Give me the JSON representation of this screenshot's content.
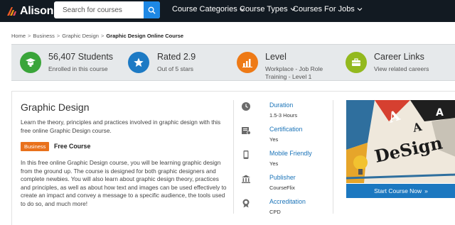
{
  "brand": {
    "name": "Alison"
  },
  "search": {
    "placeholder": "Search for courses"
  },
  "nav": [
    {
      "label": "Course Categories"
    },
    {
      "label": "Course Types"
    },
    {
      "label": "Courses For Jobs"
    }
  ],
  "breadcrumb": [
    "Home",
    "Business",
    "Graphic Design",
    "Graphic Design Online Course"
  ],
  "stats": [
    {
      "title": "56,407 Students",
      "sub": "Enrolled in this course",
      "color": "#3aa53a",
      "icon": "graduate-icon"
    },
    {
      "title": "Rated 2.9",
      "sub": "Out of 5 stars",
      "color": "#1d7ac4",
      "icon": "star-icon"
    },
    {
      "title": "Level",
      "sub": "Workplace - Job Role",
      "sub2": "Training - Level 1",
      "color": "#ee7a16",
      "icon": "bar-chart-icon"
    },
    {
      "title": "Career Links",
      "sub": "View related careers",
      "color": "#93b91e",
      "icon": "briefcase-icon"
    }
  ],
  "course": {
    "title": "Graphic Design",
    "intro": "Learn the theory, principles and practices involved in graphic design with this free online Graphic Design course.",
    "tag": "Business",
    "price": "Free Course",
    "description": "In this free online Graphic Design course, you will be learning graphic design from the ground up. The course is designed for both graphic designers and complete newbies. You will also learn about graphic design theory, practices and principles, as well as about how text and images can be used effectively to create an impact and convey a message to a specific audience, the tools used to do so, and much more!"
  },
  "details": [
    {
      "label": "Duration",
      "value": "1.5-3 Hours",
      "icon": "clock-icon"
    },
    {
      "label": "Certification",
      "value": "Yes",
      "icon": "certificate-icon"
    },
    {
      "label": "Mobile Friendly",
      "value": "Yes",
      "icon": "mobile-icon"
    },
    {
      "label": "Publisher",
      "value": "CourseFlix",
      "icon": "institution-icon"
    },
    {
      "label": "Accreditation",
      "value": "CPD",
      "icon": "award-icon"
    }
  ],
  "cta": {
    "label": "Start Course Now",
    "arrow": "»"
  },
  "image_text": "DeSign"
}
